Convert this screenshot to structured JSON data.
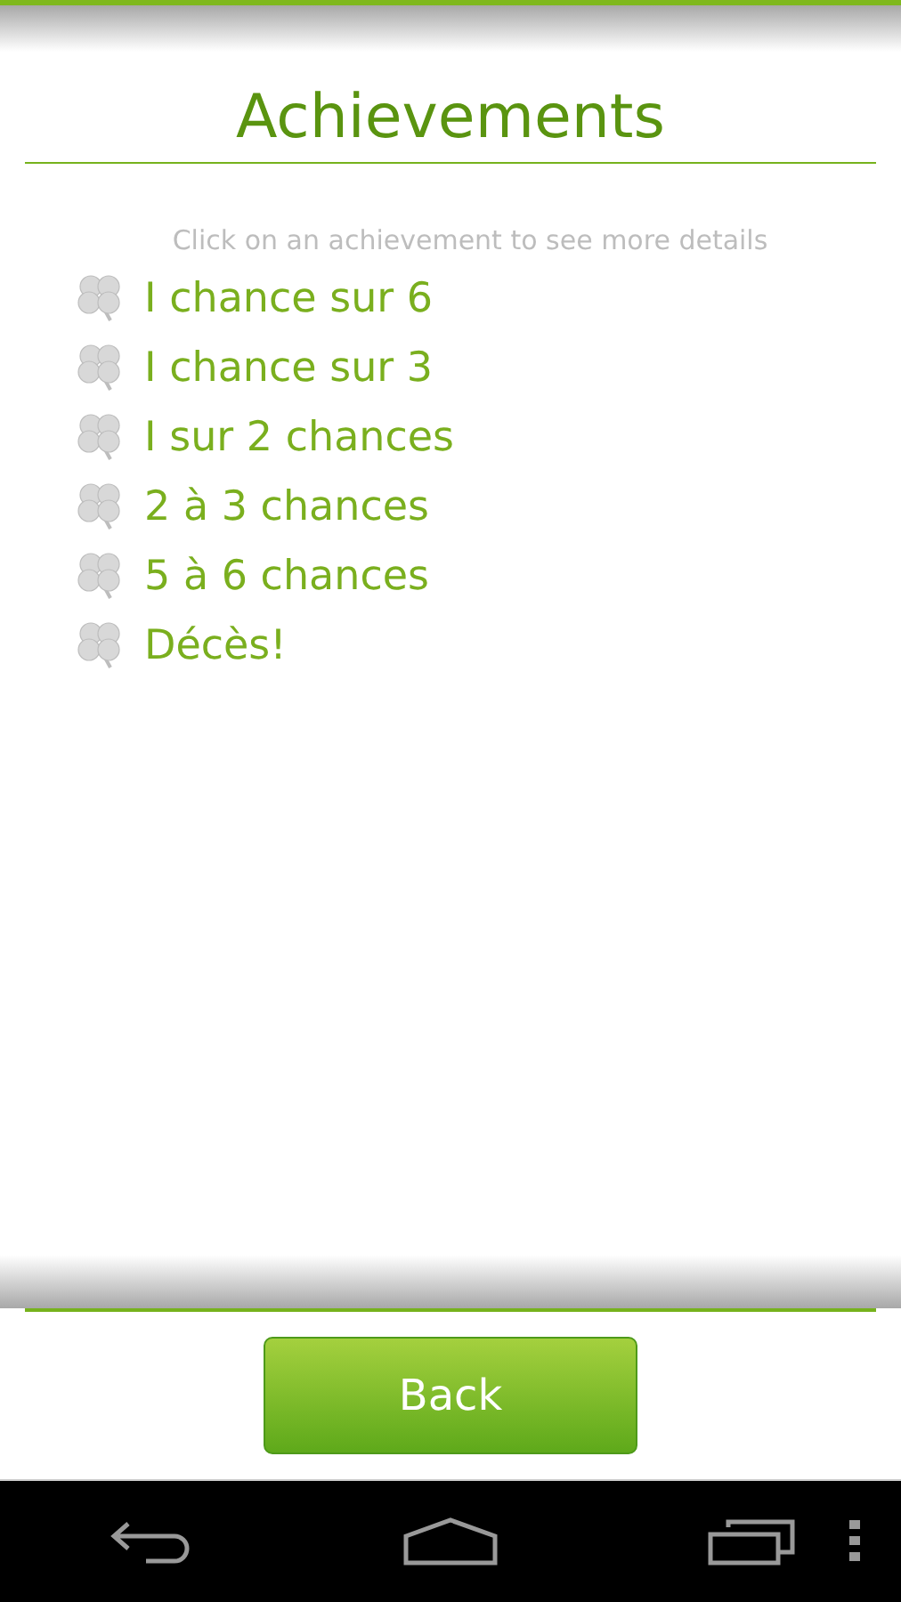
{
  "title": "Achievements",
  "hint": "Click on an achievement to see more details",
  "achievements": [
    {
      "label": "I chance sur 6",
      "unlocked": false
    },
    {
      "label": "I chance sur 3",
      "unlocked": false
    },
    {
      "label": "I sur 2 chances",
      "unlocked": false
    },
    {
      "label": "2 à 3 chances",
      "unlocked": false
    },
    {
      "label": "5 à 6 chances",
      "unlocked": false
    },
    {
      "label": "Décès!",
      "unlocked": false
    }
  ],
  "back_button": "Back"
}
